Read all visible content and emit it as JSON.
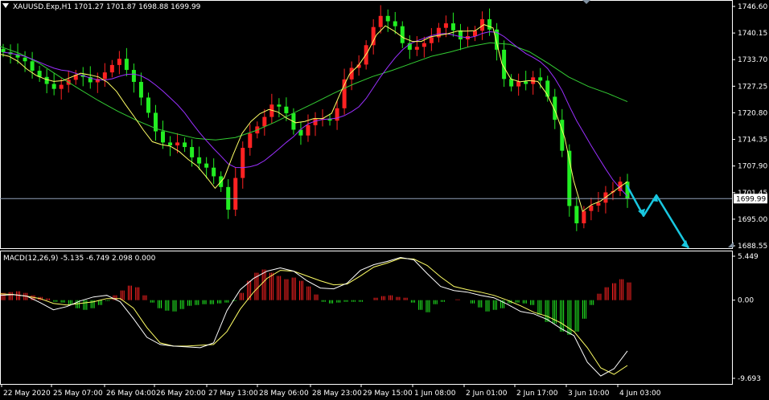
{
  "chart_data": [
    {
      "type": "candlestick",
      "title": "XAUUSD.Exp,H1  1701.27 1701.87 1698.88 1699.99",
      "symbol": "XAUUSD.Exp",
      "timeframe": "H1",
      "ohlc_text": "1701.27 1701.87 1698.88 1699.99",
      "current_price_label": "1699.99",
      "current_price": 1699.99,
      "ylim": [
        1688.55,
        1746.6
      ],
      "yticks": [
        "1746.60",
        "1740.15",
        "1733.70",
        "1727.25",
        "1720.80",
        "1714.35",
        "1707.90",
        "1701.45",
        "1695.00",
        "1688.55"
      ],
      "xticks": [
        "22 May 2020",
        "25 May 07:00",
        "26 May 04:00",
        "26 May 20:00",
        "27 May 13:00",
        "28 May 06:00",
        "28 May 23:00",
        "29 May 15:00",
        "1 Jun 08:00",
        "2 Jun 01:00",
        "2 Jun 17:00",
        "3 Jun 10:00",
        "4 Jun 03:00"
      ],
      "colors": {
        "bull": "#ff2222",
        "bear": "#22ee22",
        "ma_fast": "#ffff66",
        "ma_mid": "#9b30ff",
        "ma_slow": "#33cc33",
        "current_line": "#8fa0b8",
        "arrow": "#19c7e0",
        "axis": "#ffffff",
        "background": "#000000"
      },
      "series_close": [
        1735.5,
        1735.0,
        1734.2,
        1733.3,
        1731.0,
        1729.5,
        1727.8,
        1726.6,
        1727.6,
        1728.8,
        1730.0,
        1729.5,
        1728.2,
        1729.0,
        1730.6,
        1732.4,
        1733.9,
        1731.2,
        1728.3,
        1724.5,
        1720.8,
        1716.3,
        1713.6,
        1712.9,
        1713.6,
        1712.5,
        1710.0,
        1708.5,
        1707.5,
        1705.4,
        1702.8,
        1697.3,
        1705.0,
        1712.3,
        1715.8,
        1717.5,
        1719.8,
        1722.8,
        1722.3,
        1720.7,
        1716.7,
        1715.3,
        1717.8,
        1719.4,
        1719.4,
        1718.9,
        1721.9,
        1728.9,
        1731.7,
        1732.5,
        1737.2,
        1741.6,
        1744.3,
        1743.0,
        1741.8,
        1737.7,
        1736.1,
        1736.8,
        1737.7,
        1739.1,
        1741.4,
        1742.5,
        1740.8,
        1738.6,
        1739.4,
        1740.7,
        1743.5,
        1741.0,
        1736.1,
        1729.0,
        1727.2,
        1728.4,
        1727.8,
        1729.4,
        1728.6,
        1724.7,
        1719.1,
        1711.6,
        1698.2,
        1694.0,
        1697.0,
        1698.3,
        1699.0,
        1701.5,
        1701.8,
        1704.1,
        1699.99
      ],
      "ma_fast": [
        1735.0,
        1734.5,
        1733.3,
        1731.4,
        1729.9,
        1729.0,
        1728.4,
        1728.6,
        1729.5,
        1730.4,
        1730.0,
        1729.5,
        1728.2,
        1726.0,
        1722.8,
        1719.8,
        1716.6,
        1713.8,
        1713.1,
        1712.7,
        1711.4,
        1709.5,
        1707.9,
        1705.3,
        1702.5,
        1705.0,
        1710.6,
        1715.8,
        1718.7,
        1720.6,
        1721.6,
        1721.0,
        1719.5,
        1718.4,
        1718.7,
        1719.4,
        1719.4,
        1720.7,
        1725.7,
        1730.2,
        1732.3,
        1735.5,
        1739.7,
        1741.9,
        1740.6,
        1739.0,
        1738.1,
        1738.1,
        1739.2,
        1739.6,
        1740.0,
        1740.6,
        1740.6,
        1740.7,
        1742.2,
        1741.4,
        1732.7,
        1729.0,
        1728.3,
        1728.6,
        1728.4,
        1725.4,
        1720.9,
        1714.8,
        1704.4,
        1696.9,
        1698.5,
        1699.4,
        1701.0,
        1702.6,
        1704.1
      ],
      "ma_slow": [
        1736.9,
        1735.2,
        1732.8,
        1729.7,
        1726.7,
        1723.8,
        1721.2,
        1718.9,
        1716.9,
        1715.7,
        1714.6,
        1714.2,
        1714.8,
        1716.4,
        1718.5,
        1720.8,
        1723.1,
        1725.5,
        1727.7,
        1729.6,
        1731.1,
        1732.8,
        1734.5,
        1735.6,
        1736.9,
        1737.8,
        1737.4,
        1735.6,
        1732.7,
        1729.5,
        1727.2,
        1725.5,
        1723.5
      ]
    },
    {
      "type": "macd",
      "title": "MACD(12,26,9) -5.135 -6.749 2.098 0.000",
      "params": "MACD(12,26,9)",
      "values_text": "-5.135 -6.749 2.098 0.000",
      "yticks": [
        "5.449",
        "0.00",
        "-9.693"
      ],
      "ylim": [
        -9.693,
        5.449
      ],
      "histogram": [
        0.9,
        1.0,
        1.1,
        0.9,
        0.6,
        0.4,
        0.2,
        -0.2,
        -0.3,
        -0.5,
        -1.0,
        -1.2,
        -1.0,
        -0.6,
        -0.1,
        0.6,
        1.2,
        1.8,
        1.6,
        0.6,
        -0.3,
        -1.0,
        -1.3,
        -1.4,
        -1.1,
        -0.7,
        -0.6,
        -0.5,
        -0.5,
        -0.4,
        -0.3,
        -0.1,
        0.9,
        2.4,
        3.4,
        3.8,
        3.4,
        3.0,
        2.6,
        2.8,
        2.4,
        1.7,
        0.7,
        -0.2,
        -0.4,
        -0.3,
        -0.2,
        -0.2,
        -0.2,
        0.0,
        0.3,
        0.5,
        0.6,
        0.4,
        0.3,
        -0.3,
        -1.2,
        -1.5,
        -0.5,
        -0.2,
        0.0,
        0.1,
        0.0,
        -0.4,
        -0.9,
        -1.4,
        -1.2,
        -1.0,
        -0.4,
        -0.3,
        -0.4,
        -0.6,
        -1.8,
        -2.7,
        -2.9,
        -3.9,
        -4.3,
        -3.9,
        -2.3,
        -0.6,
        0.8,
        1.6,
        2.1,
        2.6,
        2.2
      ],
      "main_line": [
        0.6,
        0.7,
        0.5,
        -0.3,
        -1.2,
        -0.8,
        -0.1,
        0.4,
        0.6,
        -0.2,
        -2.3,
        -4.6,
        -5.5,
        -5.7,
        -5.8,
        -5.9,
        -5.3,
        -1.3,
        1.3,
        2.7,
        3.6,
        4.0,
        3.6,
        2.4,
        1.5,
        1.4,
        2.1,
        3.7,
        4.4,
        4.8,
        5.3,
        5.0,
        3.3,
        1.7,
        1.2,
        1.0,
        0.6,
        0.3,
        -0.5,
        -1.4,
        -1.7,
        -2.4,
        -3.5,
        -4.4,
        -7.7,
        -9.4,
        -8.5,
        -6.3
      ],
      "signal_line": [
        0.8,
        0.7,
        0.5,
        0.2,
        -0.4,
        -0.6,
        -0.4,
        -0.2,
        0.2,
        0.2,
        -1.0,
        -3.4,
        -5.3,
        -5.7,
        -5.7,
        -5.6,
        -5.5,
        -3.9,
        -1.1,
        1.0,
        2.7,
        3.7,
        3.6,
        3.0,
        2.4,
        1.9,
        2.0,
        3.0,
        4.1,
        4.6,
        5.2,
        5.1,
        4.3,
        2.9,
        1.7,
        1.3,
        1.0,
        0.6,
        0.0,
        -0.7,
        -1.5,
        -2.0,
        -2.8,
        -3.9,
        -5.9,
        -8.4,
        -9.2,
        -8.1
      ]
    }
  ],
  "annotations": {
    "arrow_color": "#19c7e0"
  }
}
